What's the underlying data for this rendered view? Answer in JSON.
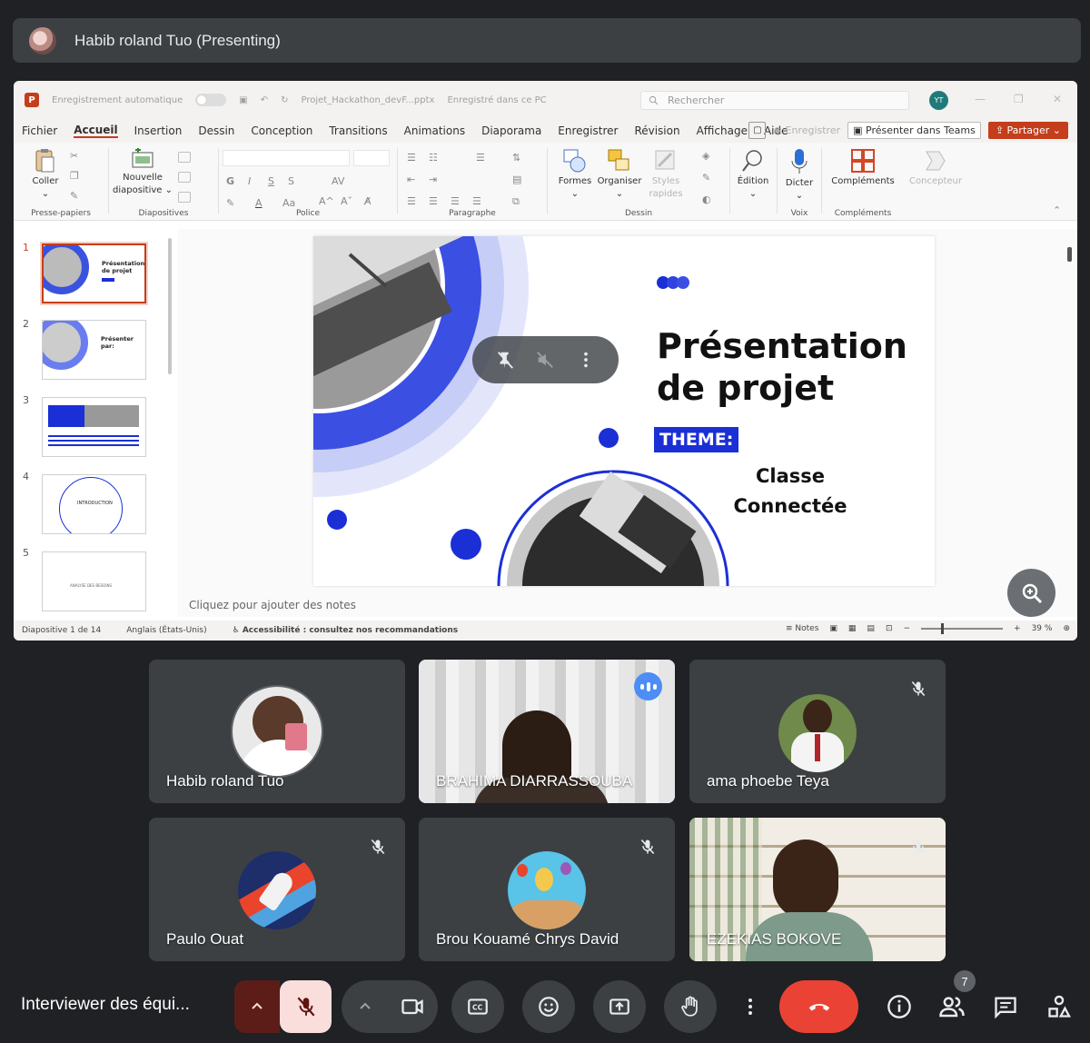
{
  "presenter_banner": {
    "text": "Habib roland Tuo (Presenting)"
  },
  "powerpoint": {
    "titlebar": {
      "autosave": "Enregistrement automatique",
      "filename": "Projet_Hackathon_devF...pptx",
      "saved_status": "Enregistré dans ce PC",
      "search_placeholder": "Rechercher",
      "user_initials": "YT"
    },
    "menu": [
      "Fichier",
      "Accueil",
      "Insertion",
      "Dessin",
      "Conception",
      "Transitions",
      "Animations",
      "Diaporama",
      "Enregistrer",
      "Révision",
      "Affichage",
      "Aide"
    ],
    "menu_active": "Accueil",
    "menu_right": {
      "record": "Enregistrer",
      "present_teams": "Présenter dans Teams",
      "share": "Partager"
    },
    "ribbon": {
      "coller": "Coller",
      "nouvelle": "Nouvelle",
      "diapositive": "diapositive",
      "formes": "Formes",
      "organiser": "Organiser",
      "styles": "Styles",
      "rapides": "rapides",
      "edition": "Édition",
      "dicter": "Dicter",
      "complements": "Compléments",
      "concepteur": "Concepteur",
      "groups": {
        "presse_papiers": "Presse-papiers",
        "diapositives": "Diapositives",
        "police": "Police",
        "paragraphe": "Paragraphe",
        "dessin": "Dessin",
        "voix": "Voix",
        "complements": "Compléments"
      }
    },
    "thumbnails": [
      {
        "num": "1",
        "title": "Présentation de projet"
      },
      {
        "num": "2",
        "title": "Présenter par:"
      },
      {
        "num": "3",
        "title": ""
      },
      {
        "num": "4",
        "title": "INTRODUCTION"
      },
      {
        "num": "5",
        "title": "ANALYSE DES BESOINS"
      }
    ],
    "slide": {
      "title_line1": "Présentation",
      "title_line2": "de projet",
      "theme_label": "THEME:",
      "subtitle_line1": "Classe",
      "subtitle_line2": "Connectée"
    },
    "notes_placeholder": "Cliquez pour ajouter des notes",
    "statusbar": {
      "slide_count": "Diapositive 1 de 14",
      "language": "Anglais (États-Unis)",
      "accessibility": "Accessibilité : consultez nos recommandations",
      "notes": "Notes",
      "zoom": "39 %"
    }
  },
  "participants": [
    {
      "name": "Habib roland Tuo",
      "muted": false,
      "speaking": false
    },
    {
      "name": "BRAHIMA DIARRASSOUBA",
      "muted": false,
      "speaking": true
    },
    {
      "name": "ama phoebe Teya",
      "muted": true,
      "speaking": false
    },
    {
      "name": "Paulo Ouat",
      "muted": true,
      "speaking": false
    },
    {
      "name": "Brou Kouamé Chrys David",
      "muted": true,
      "speaking": false
    },
    {
      "name": "EZEKIAS BOKOVE",
      "muted": true,
      "speaking": false
    }
  ],
  "meeting": {
    "name": "Interviewer des équi...",
    "participant_count": "7"
  },
  "colors": {
    "background": "#202124",
    "tile": "#3c4043",
    "end_call": "#ea4335",
    "mic_muted_bg": "#f9dedc",
    "speaking_indicator": "#4c8df6",
    "ppt_accent": "#c43e1c",
    "slide_accent_blue": "#1b2fd6"
  },
  "icons": {
    "mic_off": "mic-off-icon",
    "camera": "camera-icon",
    "captions": "cc-icon",
    "emoji": "emoji-icon",
    "present": "present-icon",
    "hand": "raise-hand-icon",
    "more": "more-vert-icon",
    "end_call": "call-end-icon",
    "info": "info-icon",
    "people": "people-icon",
    "chat": "chat-icon",
    "activities": "activities-icon"
  }
}
